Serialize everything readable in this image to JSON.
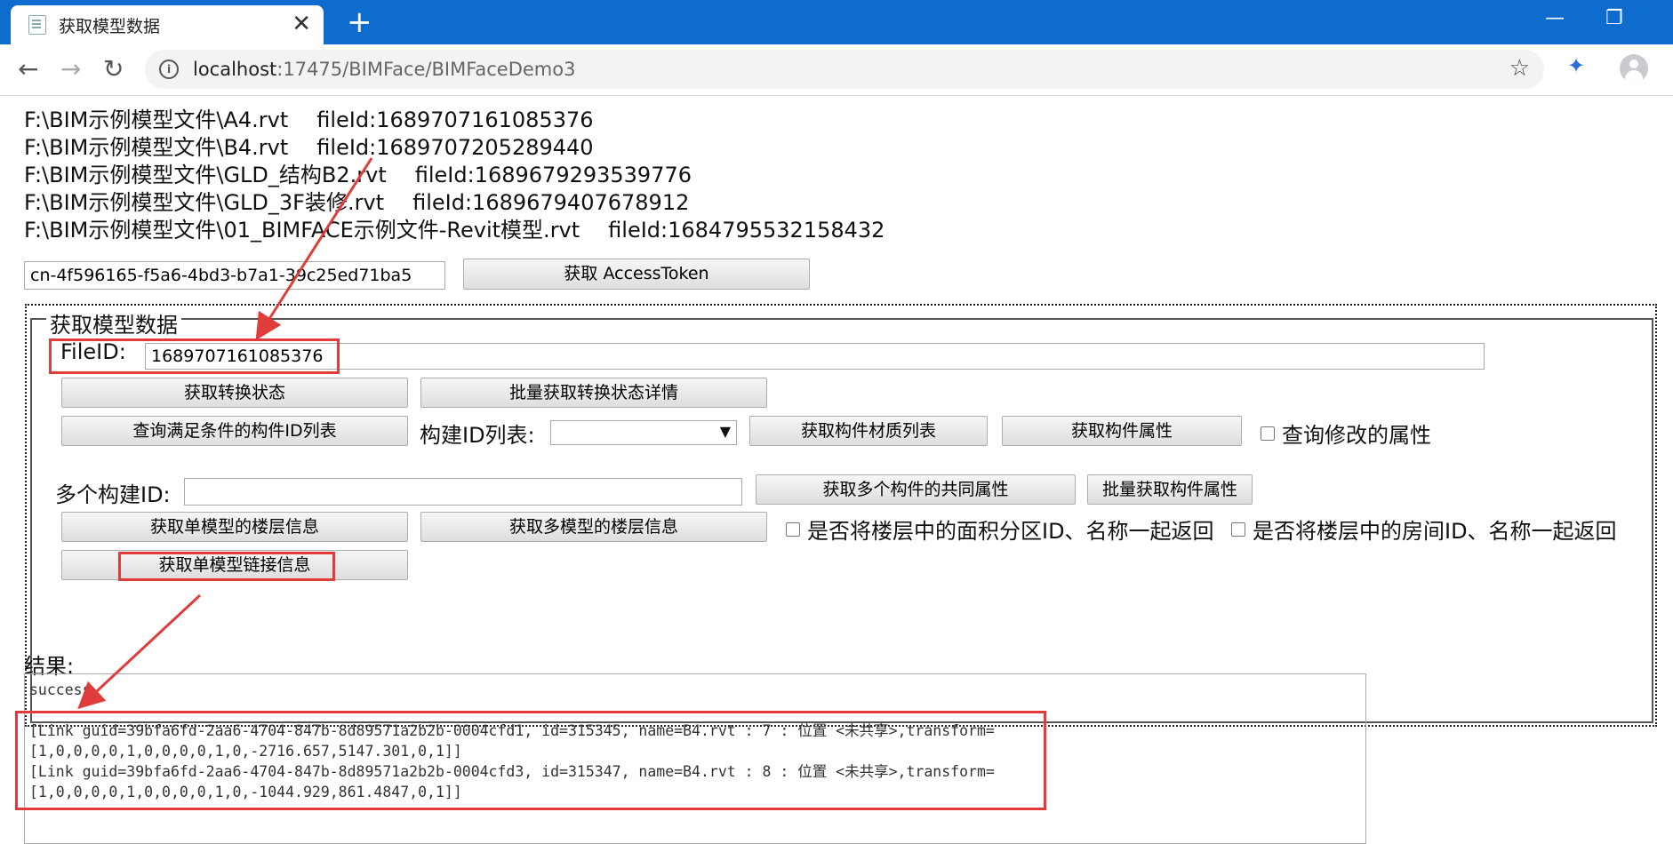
{
  "browser": {
    "tab_title": "获取模型数据",
    "tab_close": "✕",
    "new_tab": "+",
    "url_host": "localhost",
    "url_path": ":17475/BIMFace/BIMFaceDemo3",
    "window_minimize": "—",
    "window_restore": "❐"
  },
  "files": [
    {
      "path": "F:\\BIM示例模型文件\\A4.rvt",
      "file_id": "fileId:1689707161085376"
    },
    {
      "path": "F:\\BIM示例模型文件\\B4.rvt",
      "file_id": "fileId:1689707205289440"
    },
    {
      "path": "F:\\BIM示例模型文件\\GLD_结构B2.rvt",
      "file_id": "fileId:1689679293539776"
    },
    {
      "path": "F:\\BIM示例模型文件\\GLD_3F装修.rvt",
      "file_id": "fileId:1689679407678912"
    },
    {
      "path": "F:\\BIM示例模型文件\\01_BIMFACE示例文件-Revit模型.rvt",
      "file_id": "fileId:1684795532158432"
    }
  ],
  "token": {
    "value": "cn-4f596165-f5a6-4bd3-b7a1-39c25ed71ba5",
    "button": "获取 AccessToken"
  },
  "panel": {
    "legend": "获取模型数据",
    "fileid_label": "FileID:",
    "fileid_value": "1689707161085376",
    "btn_get_status": "获取转换状态",
    "btn_batch_status": "批量获取转换状态详情",
    "btn_query_ids": "查询满足条件的构件ID列表",
    "element_list_label": "构建ID列表:",
    "btn_materials": "获取构件材质列表",
    "btn_properties": "获取构件属性",
    "chk_modified": "查询修改的属性",
    "multi_label": "多个构建ID:",
    "multi_value": "",
    "btn_common_props": "获取多个构件的共同属性",
    "btn_batch_props": "批量获取构件属性",
    "btn_single_floors": "获取单模型的楼层信息",
    "btn_multi_floors": "获取多模型的楼层信息",
    "chk_area": "是否将楼层中的面积分区ID、名称一起返回",
    "chk_room": "是否将楼层中的房间ID、名称一起返回",
    "btn_links": "获取单模型链接信息"
  },
  "result": {
    "label": "结果:",
    "status": "success",
    "lines": [
      "[Link guid=39bfa6fd-2aa6-4704-847b-8d89571a2b2b-0004cfd1, id=315345, name=B4.rvt : 7 : 位置 <未共享>,transform=",
      "[1,0,0,0,0,1,0,0,0,0,1,0,-2716.657,5147.301,0,1]]",
      "[Link guid=39bfa6fd-2aa6-4704-847b-8d89571a2b2b-0004cfd3, id=315347, name=B4.rvt : 8 : 位置 <未共享>,transform=",
      "[1,0,0,0,0,1,0,0,0,0,1,0,-1044.929,861.4847,0,1]]"
    ]
  },
  "colors": {
    "chrome_blue": "#0f6ccf",
    "highlight_red": "#e03c3c"
  }
}
